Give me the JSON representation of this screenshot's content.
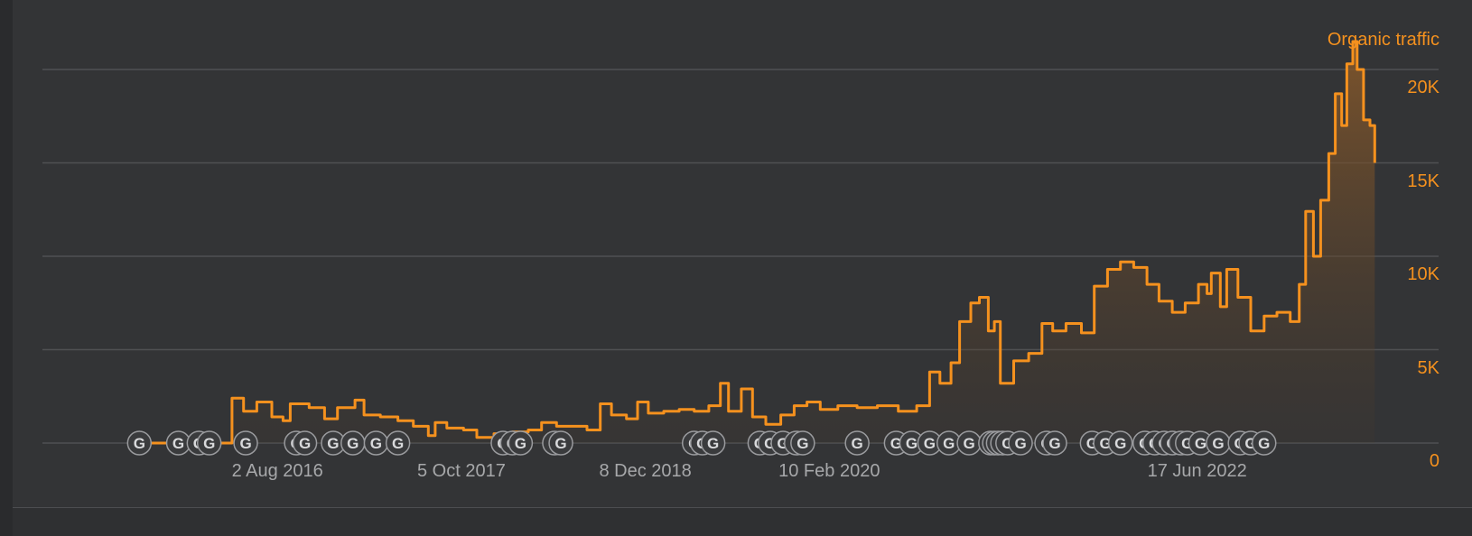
{
  "chart_data": {
    "type": "line",
    "series": [
      {
        "name": "Organic traffic",
        "color": "#f5911e",
        "points": [
          [
            "2015-09-01",
            0
          ],
          [
            "2015-10-15",
            0
          ],
          [
            "2015-12-01",
            0
          ],
          [
            "2016-01-15",
            0
          ],
          [
            "2016-03-01",
            0
          ],
          [
            "2016-04-10",
            0
          ],
          [
            "2016-04-18",
            2400
          ],
          [
            "2016-05-15",
            1700
          ],
          [
            "2016-06-15",
            2200
          ],
          [
            "2016-07-20",
            1400
          ],
          [
            "2016-08-15",
            1200
          ],
          [
            "2016-09-01",
            2100
          ],
          [
            "2016-10-15",
            1900
          ],
          [
            "2016-11-20",
            1300
          ],
          [
            "2016-12-20",
            1900
          ],
          [
            "2017-01-30",
            2300
          ],
          [
            "2017-02-20",
            1500
          ],
          [
            "2017-03-30",
            1400
          ],
          [
            "2017-05-10",
            1200
          ],
          [
            "2017-06-15",
            900
          ],
          [
            "2017-07-20",
            400
          ],
          [
            "2017-08-05",
            1100
          ],
          [
            "2017-09-01",
            800
          ],
          [
            "2017-10-10",
            700
          ],
          [
            "2017-11-10",
            300
          ],
          [
            "2017-12-20",
            500
          ],
          [
            "2018-02-01",
            600
          ],
          [
            "2018-03-10",
            700
          ],
          [
            "2018-04-10",
            1100
          ],
          [
            "2018-05-15",
            900
          ],
          [
            "2018-06-20",
            900
          ],
          [
            "2018-07-25",
            700
          ],
          [
            "2018-08-25",
            2100
          ],
          [
            "2018-09-20",
            1500
          ],
          [
            "2018-10-25",
            1300
          ],
          [
            "2018-11-20",
            2200
          ],
          [
            "2018-12-15",
            1600
          ],
          [
            "2019-01-20",
            1700
          ],
          [
            "2019-02-25",
            1800
          ],
          [
            "2019-04-01",
            1700
          ],
          [
            "2019-05-05",
            2000
          ],
          [
            "2019-06-01",
            3200
          ],
          [
            "2019-06-20",
            1700
          ],
          [
            "2019-07-20",
            2900
          ],
          [
            "2019-08-15",
            1400
          ],
          [
            "2019-09-15",
            1000
          ],
          [
            "2019-10-20",
            1500
          ],
          [
            "2019-11-20",
            2000
          ],
          [
            "2019-12-20",
            2200
          ],
          [
            "2020-01-20",
            1800
          ],
          [
            "2020-03-01",
            2000
          ],
          [
            "2020-04-15",
            1900
          ],
          [
            "2020-06-01",
            2000
          ],
          [
            "2020-07-20",
            1700
          ],
          [
            "2020-09-01",
            2000
          ],
          [
            "2020-10-01",
            3800
          ],
          [
            "2020-10-25",
            3200
          ],
          [
            "2020-11-20",
            4300
          ],
          [
            "2020-12-10",
            6500
          ],
          [
            "2021-01-05",
            7500
          ],
          [
            "2021-01-25",
            7800
          ],
          [
            "2021-02-15",
            6000
          ],
          [
            "2021-03-01",
            6500
          ],
          [
            "2021-03-15",
            3200
          ],
          [
            "2021-04-15",
            4400
          ],
          [
            "2021-05-20",
            4800
          ],
          [
            "2021-06-20",
            6400
          ],
          [
            "2021-07-15",
            6000
          ],
          [
            "2021-08-15",
            6400
          ],
          [
            "2021-09-20",
            5900
          ],
          [
            "2021-10-20",
            8400
          ],
          [
            "2021-11-20",
            9300
          ],
          [
            "2021-12-20",
            9700
          ],
          [
            "2022-01-20",
            9400
          ],
          [
            "2022-02-20",
            8500
          ],
          [
            "2022-03-20",
            7600
          ],
          [
            "2022-04-20",
            7000
          ],
          [
            "2022-05-20",
            7500
          ],
          [
            "2022-06-20",
            8500
          ],
          [
            "2022-07-10",
            8000
          ],
          [
            "2022-07-20",
            9100
          ],
          [
            "2022-08-10",
            7300
          ],
          [
            "2022-08-25",
            9300
          ],
          [
            "2022-09-20",
            7800
          ],
          [
            "2022-10-20",
            6000
          ],
          [
            "2022-11-20",
            6800
          ],
          [
            "2022-12-20",
            7000
          ],
          [
            "2023-01-20",
            6500
          ],
          [
            "2023-02-10",
            8500
          ],
          [
            "2023-02-25",
            12400
          ],
          [
            "2023-03-15",
            10000
          ],
          [
            "2023-04-01",
            13000
          ],
          [
            "2023-04-20",
            15500
          ],
          [
            "2023-05-05",
            18700
          ],
          [
            "2023-05-20",
            17000
          ],
          [
            "2023-06-01",
            20300
          ],
          [
            "2023-06-15",
            21500
          ],
          [
            "2023-06-25",
            20000
          ],
          [
            "2023-07-10",
            17300
          ],
          [
            "2023-07-25",
            17000
          ],
          [
            "2023-08-05",
            15000
          ]
        ]
      }
    ],
    "x_tick_labels": [
      "2 Aug 2016",
      "5 Oct 2017",
      "8 Dec 2018",
      "10 Feb 2020",
      "17 Jun 2022"
    ],
    "x_tick_dates": [
      "2016-08-02",
      "2017-10-05",
      "2018-12-08",
      "2020-02-10",
      "2022-06-17"
    ],
    "y_tick_labels": [
      "0",
      "5K",
      "10K",
      "15K",
      "20K"
    ],
    "y_tick_values": [
      0,
      5000,
      10000,
      15000,
      20000
    ],
    "ylim": [
      0,
      20000
    ],
    "xlim": [
      "2015-02-01",
      "2024-01-01"
    ],
    "grid": true,
    "annotation_marker": "G",
    "annotation_dates": [
      "2015-09-15",
      "2015-12-15",
      "2016-02-01",
      "2016-02-25",
      "2016-05-20",
      "2016-09-15",
      "2016-10-05",
      "2016-12-10",
      "2017-01-25",
      "2017-03-20",
      "2017-05-10",
      "2018-01-10",
      "2018-02-01",
      "2018-02-20",
      "2018-05-10",
      "2018-05-25",
      "2019-04-01",
      "2019-04-20",
      "2019-05-15",
      "2019-09-01",
      "2019-09-25",
      "2019-10-25",
      "2019-11-25",
      "2019-12-10",
      "2020-04-15",
      "2020-07-15",
      "2020-08-20",
      "2020-10-01",
      "2020-11-15",
      "2021-01-01",
      "2021-02-20",
      "2021-03-01",
      "2021-03-10",
      "2021-03-20",
      "2021-04-01",
      "2021-05-01",
      "2021-07-01",
      "2021-07-20",
      "2021-10-15",
      "2021-11-15",
      "2021-12-20",
      "2022-02-15",
      "2022-03-10",
      "2022-04-01",
      "2022-04-20",
      "2022-05-10",
      "2022-05-25",
      "2022-06-25",
      "2022-08-05",
      "2022-09-25",
      "2022-10-20",
      "2022-11-20"
    ],
    "axis_position": "right"
  }
}
